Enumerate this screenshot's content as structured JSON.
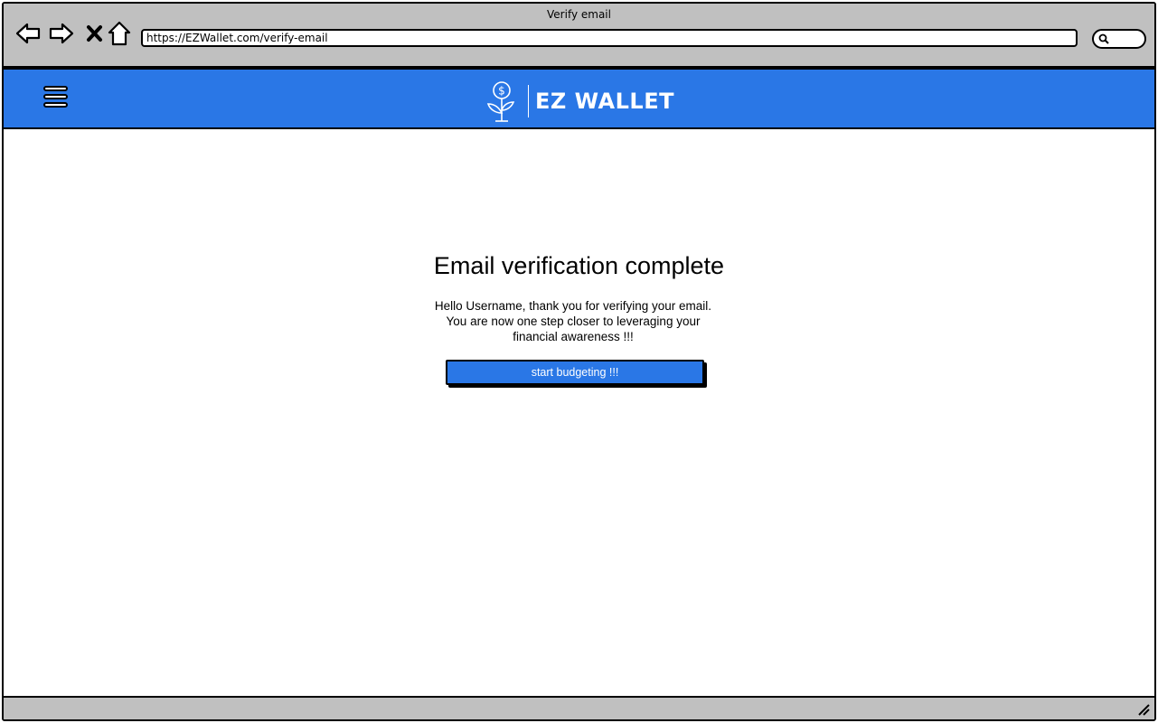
{
  "window": {
    "title": "Verify email",
    "url": "https://EZWallet.com/verify-email"
  },
  "header": {
    "brand": "EZ WALLET",
    "menu_icon": "hamburger-menu-icon",
    "logo_icon": "dollar-plant-icon",
    "background_color": "#2a77e6"
  },
  "main": {
    "heading": "Email verification complete",
    "message_lines": [
      "Hello Username, thank you for verifying your email.",
      "You are now one step closer to leveraging your",
      "financial awareness !!!"
    ],
    "cta_label": "start budgeting !!!"
  },
  "icons": {
    "back": "back-arrow-icon",
    "forward": "forward-arrow-icon",
    "stop": "close-icon",
    "home": "home-icon",
    "search": "search-icon",
    "resize": "resize-grip-icon"
  }
}
